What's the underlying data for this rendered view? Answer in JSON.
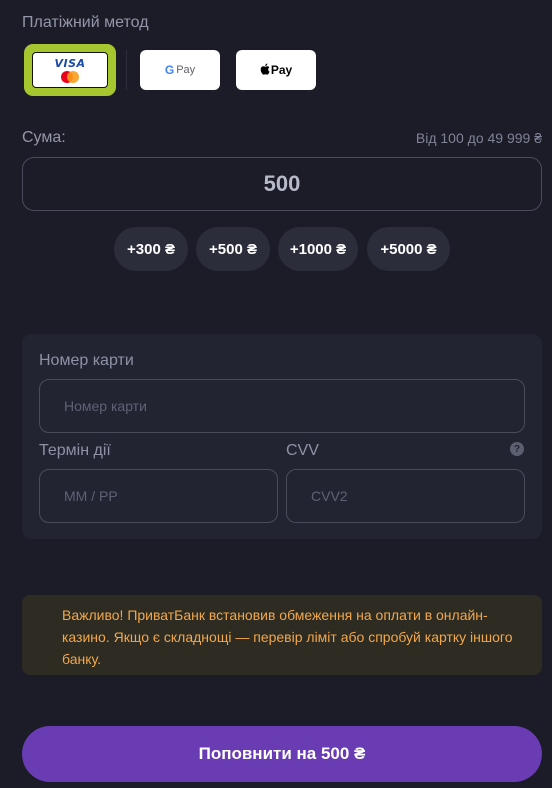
{
  "payment": {
    "label": "Платіжний метод",
    "methods": [
      {
        "name": "card",
        "visa": "VISA",
        "selected": true
      },
      {
        "name": "google-pay",
        "text": "Pay"
      },
      {
        "name": "apple-pay",
        "text": "Pay"
      }
    ]
  },
  "amount": {
    "label": "Сума:",
    "range": "Від 100 до 49 999 ₴",
    "value": "500",
    "presets": [
      "+300 ₴",
      "+500 ₴",
      "+1000 ₴",
      "+5000 ₴"
    ]
  },
  "card_form": {
    "number_label": "Номер карти",
    "number_placeholder": "Номер карти",
    "expiry_label": "Термін дії",
    "expiry_placeholder": "MM / PP",
    "cvv_label": "CVV",
    "cvv_placeholder": "CVV2",
    "help_icon": "?"
  },
  "warning": {
    "text": "Важливо! ПриватБанк встановив обмеження на оплати в онлайн-казино. Якщо є складнощі — перевір ліміт або спробуй картку іншого банку."
  },
  "submit": {
    "label": "Поповнити на 500 ₴"
  },
  "colors": {
    "background": "#1b1c27",
    "selected_border": "#a6c630",
    "submit_button": "#6a3cb4",
    "warning_text": "#f2a84a"
  }
}
